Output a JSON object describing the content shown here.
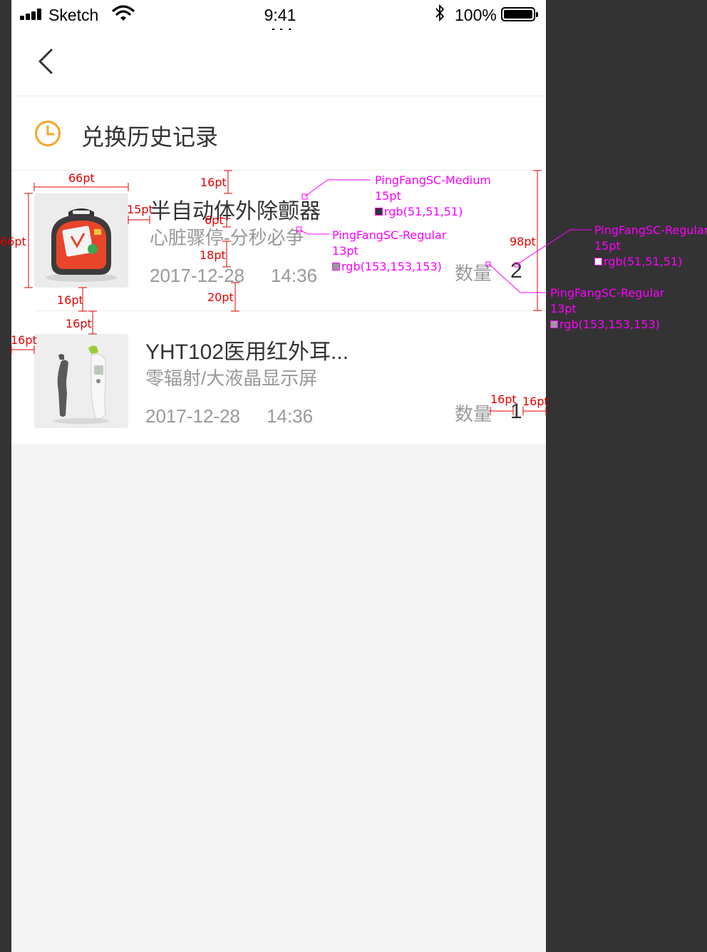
{
  "status_bar": {
    "carrier": "Sketch",
    "time": "9:41 AM",
    "battery": "100%"
  },
  "nav": {
    "back_icon": "chevron-left-icon"
  },
  "section": {
    "icon": "clock-icon",
    "title": "兑换历史记录",
    "accent_color": "#f5a623"
  },
  "orders": [
    {
      "name": "半自动体外除颤器",
      "desc": "心脏骤停-分秒必争",
      "date": "2017-12-28",
      "time": "14:36",
      "qty_label": "数量",
      "qty": "2"
    },
    {
      "name": "YHT102医用红外耳...",
      "desc": "零辐射/大液晶显示屏",
      "date": "2017-12-28",
      "time": "14:36",
      "qty_label": "数量",
      "qty": "1"
    }
  ],
  "annotations": {
    "m1": "66pt",
    "m2": "66pt",
    "m3": "16pt",
    "m4": "15pt",
    "m5": "6pt",
    "m6": "18pt",
    "m7": "20pt",
    "m8": "16pt",
    "m9": "16pt",
    "m10": "16pt",
    "m11": "98pt",
    "m12": "16pt",
    "m13": "16pt",
    "spec1": {
      "font": "PingFangSC-Medium",
      "size": "15pt",
      "color": "rgb(51,51,51)"
    },
    "spec2": {
      "font": "PingFangSC-Regular",
      "size": "13pt",
      "color": "rgb(153,153,153)"
    },
    "spec3": {
      "font": "PingFangSC-Regular",
      "size": "15pt",
      "color": "rgb(51,51,51)"
    },
    "spec4": {
      "font": "PingFangSC-Regular",
      "size": "13pt",
      "color": "rgb(153,153,153)"
    }
  }
}
